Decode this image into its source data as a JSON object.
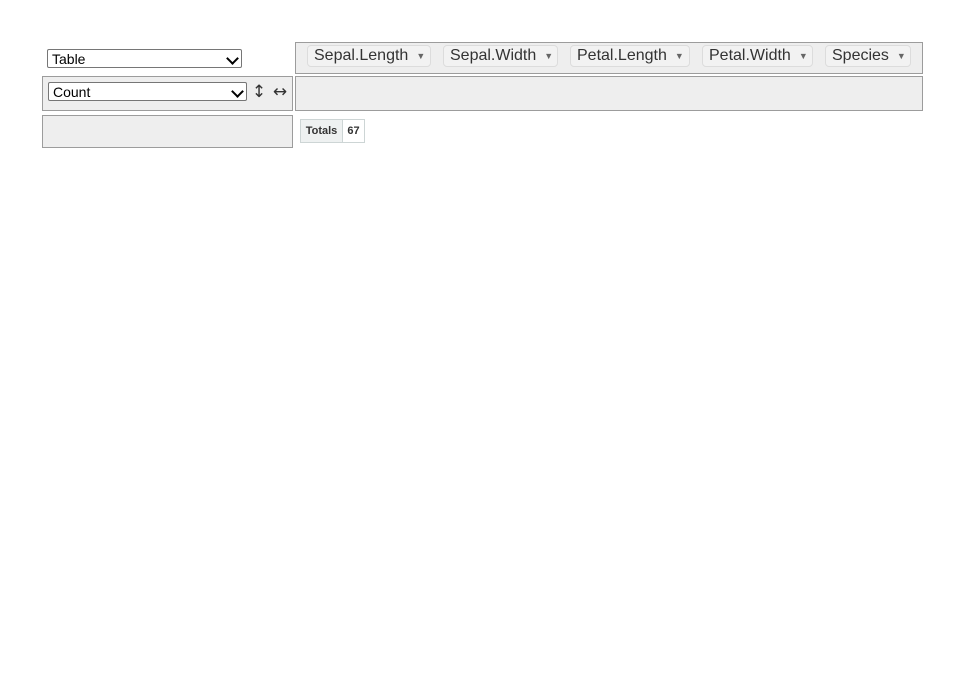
{
  "renderer": {
    "selected": "Table"
  },
  "aggregator": {
    "selected": "Count"
  },
  "attributes": [
    {
      "label": "Sepal.Length",
      "arrow": "▼"
    },
    {
      "label": "Sepal.Width",
      "arrow": "▼"
    },
    {
      "label": "Petal.Length",
      "arrow": "▼"
    },
    {
      "label": "Petal.Width",
      "arrow": "▼"
    },
    {
      "label": "Species",
      "arrow": "▼"
    }
  ],
  "controls": {
    "row_order_icon": "↕",
    "col_order_icon": "↔"
  },
  "table": {
    "totals_label": "Totals",
    "totals_value": "67"
  }
}
